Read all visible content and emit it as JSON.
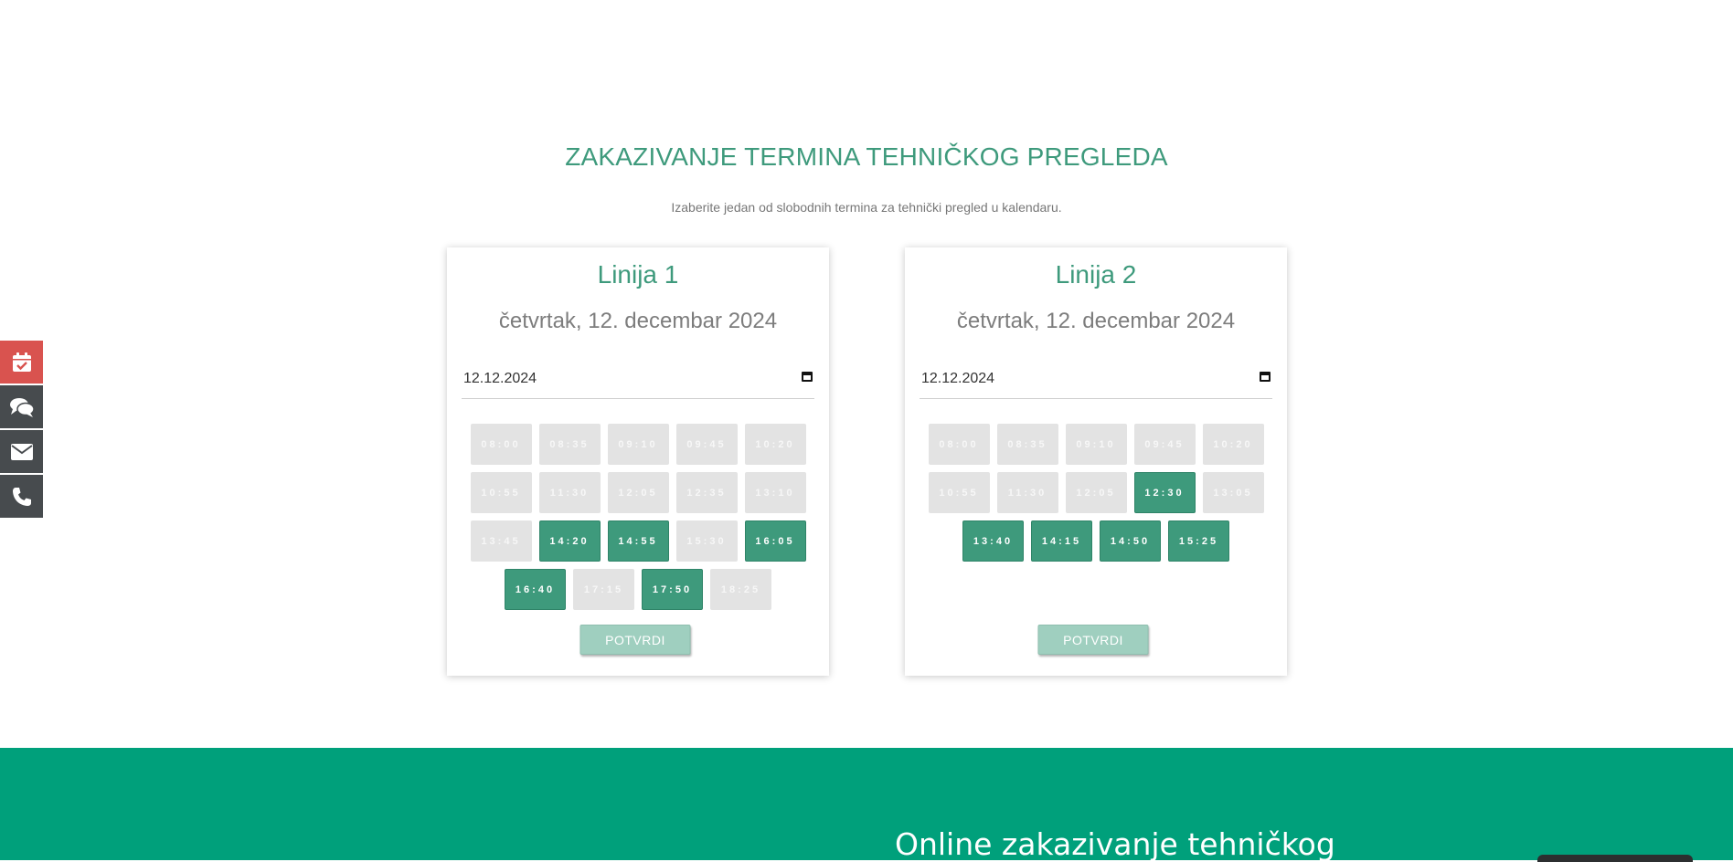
{
  "header": {
    "title": "ZAKAZIVANJE TERMINA TEHNIČKOG PREGLEDA",
    "subtitle": "Izaberite jedan od slobodnih termina za tehnički pregled u kalendaru."
  },
  "lines": [
    {
      "title": "Linija 1",
      "date_long": "četvrtak, 12. decembar 2024",
      "date_value": "12.12.2024",
      "slots": [
        {
          "time": "08:00",
          "available": false
        },
        {
          "time": "08:35",
          "available": false
        },
        {
          "time": "09:10",
          "available": false
        },
        {
          "time": "09:45",
          "available": false
        },
        {
          "time": "10:20",
          "available": false
        },
        {
          "time": "10:55",
          "available": false
        },
        {
          "time": "11:30",
          "available": false
        },
        {
          "time": "12:05",
          "available": false
        },
        {
          "time": "12:35",
          "available": false
        },
        {
          "time": "13:10",
          "available": false
        },
        {
          "time": "13:45",
          "available": false
        },
        {
          "time": "14:20",
          "available": true
        },
        {
          "time": "14:55",
          "available": true
        },
        {
          "time": "15:30",
          "available": false
        },
        {
          "time": "16:05",
          "available": true
        },
        {
          "time": "16:40",
          "available": true
        },
        {
          "time": "17:15",
          "available": false
        },
        {
          "time": "17:50",
          "available": true
        },
        {
          "time": "18:25",
          "available": false
        }
      ],
      "confirm_label": "POTVRDI"
    },
    {
      "title": "Linija 2",
      "date_long": "četvrtak, 12. decembar 2024",
      "date_value": "12.12.2024",
      "slots": [
        {
          "time": "08:00",
          "available": false
        },
        {
          "time": "08:35",
          "available": false
        },
        {
          "time": "09:10",
          "available": false
        },
        {
          "time": "09:45",
          "available": false
        },
        {
          "time": "10:20",
          "available": false
        },
        {
          "time": "10:55",
          "available": false
        },
        {
          "time": "11:30",
          "available": false
        },
        {
          "time": "12:05",
          "available": false
        },
        {
          "time": "12:30",
          "available": true
        },
        {
          "time": "13:05",
          "available": false
        },
        {
          "time": "13:40",
          "available": true
        },
        {
          "time": "14:15",
          "available": true
        },
        {
          "time": "14:50",
          "available": true
        },
        {
          "time": "15:25",
          "available": true
        }
      ],
      "confirm_label": "POTVRDI"
    }
  ],
  "sidebar": {
    "items": [
      {
        "icon": "calendar-check-icon",
        "color": "#d9534f"
      },
      {
        "icon": "chat-icon",
        "color": "#474b4e"
      },
      {
        "icon": "envelope-icon",
        "color": "#474b4e"
      },
      {
        "icon": "phone-icon",
        "color": "#474b4e"
      }
    ]
  },
  "footer": {
    "heading": "Online zakazivanje tehničkog"
  },
  "colors": {
    "accent": "#3e9a7c",
    "footer_bg": "#00a07b",
    "slot_unavailable": "#e3e3e3",
    "confirm_disabled": "#9fcfbf"
  }
}
